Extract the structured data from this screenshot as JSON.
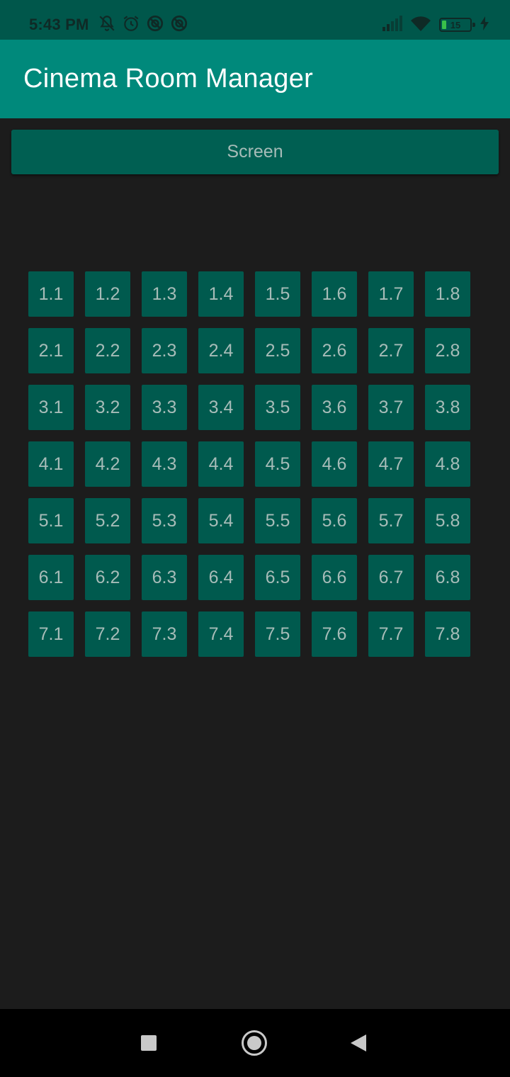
{
  "status_bar": {
    "time": "5:43 PM",
    "battery_level": "15",
    "battery_fill_fraction": 0.15,
    "icons_left": [
      "notifications-off-icon",
      "alarm-icon",
      "vpn-icon",
      "vpn-icon"
    ],
    "icons_right": [
      "signal-icon",
      "wifi-icon",
      "battery-icon",
      "charging-icon"
    ]
  },
  "app_bar": {
    "title": "Cinema Room Manager"
  },
  "screen": {
    "label": "Screen"
  },
  "seats": {
    "rows": [
      [
        "1.1",
        "1.2",
        "1.3",
        "1.4",
        "1.5",
        "1.6",
        "1.7",
        "1.8"
      ],
      [
        "2.1",
        "2.2",
        "2.3",
        "2.4",
        "2.5",
        "2.6",
        "2.7",
        "2.8"
      ],
      [
        "3.1",
        "3.2",
        "3.3",
        "3.4",
        "3.5",
        "3.6",
        "3.7",
        "3.8"
      ],
      [
        "4.1",
        "4.2",
        "4.3",
        "4.4",
        "4.5",
        "4.6",
        "4.7",
        "4.8"
      ],
      [
        "5.1",
        "5.2",
        "5.3",
        "5.4",
        "5.5",
        "5.6",
        "5.7",
        "5.8"
      ],
      [
        "6.1",
        "6.2",
        "6.3",
        "6.4",
        "6.5",
        "6.6",
        "6.7",
        "6.8"
      ],
      [
        "7.1",
        "7.2",
        "7.3",
        "7.4",
        "7.5",
        "7.6",
        "7.7",
        "7.8"
      ]
    ]
  },
  "nav_bar": {
    "buttons": [
      "recents-icon",
      "home-icon",
      "back-icon"
    ]
  },
  "colors": {
    "status_bar": "#00574b",
    "app_bar": "#00897b",
    "seat": "#005a4e",
    "background": "#1c1c1c",
    "text_muted": "#a7bcb8"
  }
}
